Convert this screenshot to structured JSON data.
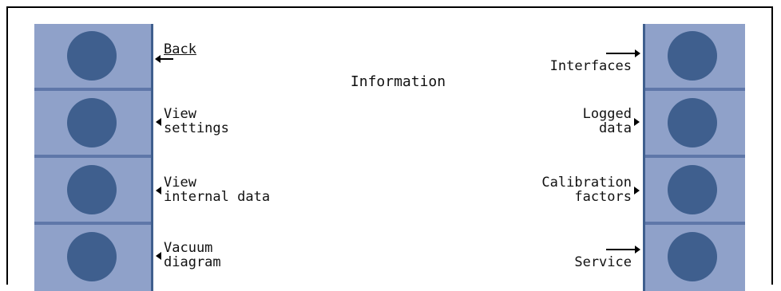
{
  "screen": {
    "title": "Information"
  },
  "left_softkeys": [
    {
      "line1": "Back",
      "line2": ""
    },
    {
      "line1": "View",
      "line2": "settings"
    },
    {
      "line1": "View",
      "line2": "internal data"
    },
    {
      "line1": "Vacuum",
      "line2": "diagram"
    }
  ],
  "right_softkeys": [
    {
      "line1": "Interfaces",
      "line2": ""
    },
    {
      "line1": "Logged",
      "line2": "data"
    },
    {
      "line1": "Calibration",
      "line2": "factors"
    },
    {
      "line1": "Service",
      "line2": ""
    }
  ],
  "colors": {
    "panel": "#8fa1c9",
    "knob": "#3f5f8e",
    "divider": "#5f77a9",
    "screen_bg": "#ffffff"
  }
}
